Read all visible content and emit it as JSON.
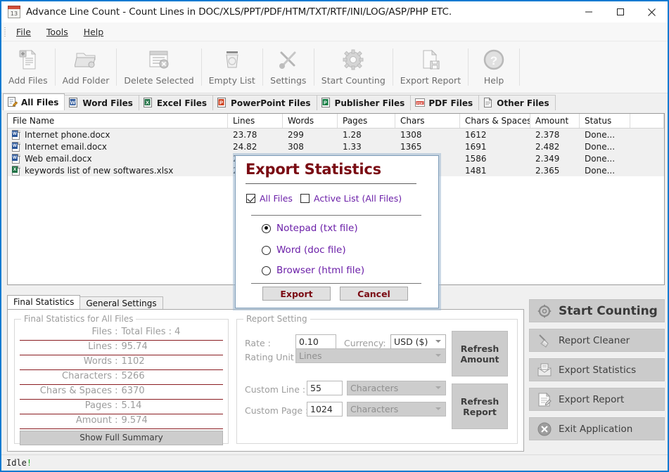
{
  "window": {
    "title": "Advance Line Count - Count Lines in DOC/XLS/PPT/PDF/HTM/TXT/RTF/INI/LOG/ASP/PHP ETC.",
    "minimize": "—",
    "maximize": "□",
    "close": "×"
  },
  "menu": {
    "items": [
      {
        "label": "File"
      },
      {
        "label": "Tools"
      },
      {
        "label": "Help"
      }
    ]
  },
  "toolbar": {
    "buttons": [
      {
        "label": "Add Files",
        "icon": "add-files-icon"
      },
      {
        "label": "Add Folder",
        "icon": "add-folder-icon"
      },
      {
        "label": "Delete Selected",
        "icon": "delete-selected-icon"
      },
      {
        "label": "Empty List",
        "icon": "empty-list-icon"
      },
      {
        "label": "Settings",
        "icon": "settings-icon"
      },
      {
        "label": "Start Counting",
        "icon": "start-counting-icon"
      },
      {
        "label": "Export Report",
        "icon": "export-report-icon"
      },
      {
        "label": "Help",
        "icon": "help-icon"
      }
    ]
  },
  "file_tabs": [
    {
      "label": "All Files",
      "icon": "all-files-icon",
      "active": true
    },
    {
      "label": "Word Files",
      "icon": "word-icon",
      "active": false
    },
    {
      "label": "Excel Files",
      "icon": "excel-icon",
      "active": false
    },
    {
      "label": "PowerPoint Files",
      "icon": "powerpoint-icon",
      "active": false
    },
    {
      "label": "Publisher Files",
      "icon": "publisher-icon",
      "active": false
    },
    {
      "label": "PDF Files",
      "icon": "pdf-icon",
      "active": false
    },
    {
      "label": "Other Files",
      "icon": "other-files-icon",
      "active": false
    }
  ],
  "file_list": {
    "columns": [
      "File Name",
      "Lines",
      "Words",
      "Pages",
      "Chars",
      "Chars & Spaces",
      "Amount",
      "Status"
    ],
    "rows": [
      {
        "name": "Internet phone.docx",
        "icon": "word-doc-icon",
        "lines": "23.78",
        "words": "299",
        "pages": "1.28",
        "chars": "1308",
        "chars_spaces": "1612",
        "amount": "2.378",
        "status": "Done..."
      },
      {
        "name": "Internet email.docx",
        "icon": "word-doc-icon",
        "lines": "24.82",
        "words": "308",
        "pages": "1.33",
        "chars": "1365",
        "chars_spaces": "1691",
        "amount": "2.482",
        "status": "Done..."
      },
      {
        "name": "Web email.docx",
        "icon": "word-doc-icon",
        "lines": "2",
        "words": "",
        "pages": "",
        "chars": "",
        "chars_spaces": "1586",
        "amount": "2.349",
        "status": "Done..."
      },
      {
        "name": "keywords list of new softwares.xlsx",
        "icon": "excel-doc-icon",
        "lines": "2",
        "words": "",
        "pages": "",
        "chars": "",
        "chars_spaces": "1481",
        "amount": "2.365",
        "status": "Done..."
      }
    ]
  },
  "bottom_tabs": [
    {
      "label": "Final Statistics",
      "active": true
    },
    {
      "label": "General Settings",
      "active": false
    }
  ],
  "final_statistics": {
    "group_title": "Final Statistics for All Files",
    "rows": [
      {
        "label": "Files :",
        "value": "Total Files : 4"
      },
      {
        "label": "Lines :",
        "value": "95.74"
      },
      {
        "label": "Words :",
        "value": "1102"
      },
      {
        "label": "Characters :",
        "value": "5266"
      },
      {
        "label": "Chars & Spaces :",
        "value": "6370"
      },
      {
        "label": "Pages :",
        "value": "5.14"
      },
      {
        "label": "Amount :",
        "value": "9.574"
      }
    ],
    "summary_button": "Show Full Summary"
  },
  "report_setting": {
    "group_title": "Report Setting",
    "rate_label": "Rate :",
    "rate_value": "0.10",
    "currency_label": "Currency:",
    "currency_value": "USD ($)",
    "rating_unit_label": "Rating Unit :",
    "rating_unit_value": "Lines",
    "custom_line_label": "Custom Line :",
    "custom_line_value": "55",
    "custom_line_unit": "Characters",
    "custom_page_label": "Custom Page :",
    "custom_page_value": "1024",
    "custom_page_unit": "Characters",
    "refresh_amount": [
      "Refresh",
      "Amount"
    ],
    "refresh_report": [
      "Refresh",
      "Report"
    ]
  },
  "actions": [
    {
      "label": "Start Counting",
      "icon": "gear-icon"
    },
    {
      "label": "Report Cleaner",
      "icon": "broom-icon"
    },
    {
      "label": "Export Statistics",
      "icon": "export-statistics-icon"
    },
    {
      "label": "Export Report",
      "icon": "export-report-icon"
    },
    {
      "label": "Exit Application",
      "icon": "exit-icon"
    }
  ],
  "statusbar": {
    "text": "Idle",
    "suffix": "!"
  },
  "dialog": {
    "title": "Export Statistics",
    "checkbox_all_files": {
      "label": "All Files",
      "checked": true
    },
    "checkbox_active_list": {
      "label": "Active List (All Files)",
      "checked": false
    },
    "radios": [
      {
        "label": "Notepad (txt file)",
        "selected": true
      },
      {
        "label": "Word (doc file)",
        "selected": false
      },
      {
        "label": "Browser (html file)",
        "selected": false
      }
    ],
    "export_button": "Export",
    "cancel_button": "Cancel"
  },
  "colors": {
    "window_border": "#0a7ad1",
    "dialog_title": "#7a0b13",
    "dialog_label": "#6b1fa8",
    "stat_underline": "#8a1c21",
    "status_ok": "#1fa81f"
  }
}
